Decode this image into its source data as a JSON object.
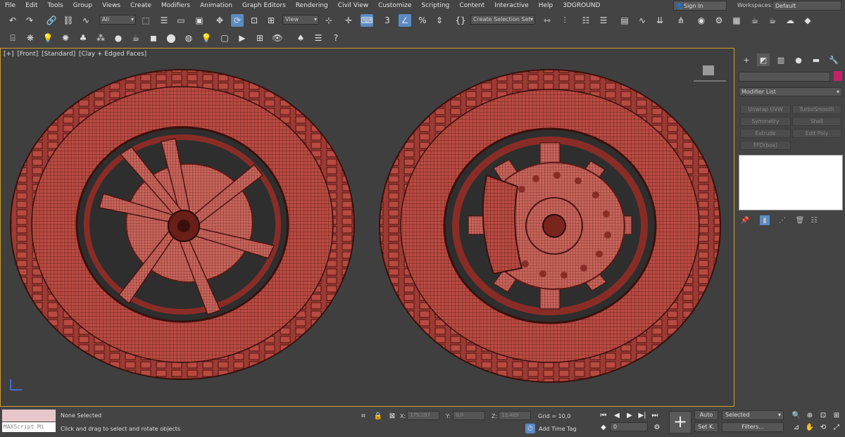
{
  "menu": [
    "File",
    "Edit",
    "Tools",
    "Group",
    "Views",
    "Create",
    "Modifiers",
    "Animation",
    "Graph Editors",
    "Rendering",
    "Civil View",
    "Customize",
    "Scripting",
    "Content",
    "Interactive",
    "Help",
    "3DGROUND"
  ],
  "signin": {
    "label": "Sign In"
  },
  "workspace": {
    "label": "Workspaces:",
    "value": "Default"
  },
  "toolbar": {
    "selection_filter": "All",
    "ref_coord": "View",
    "selection_set": "Create Selection Set"
  },
  "viewport": {
    "label_plus": "[+]",
    "label_view": "[Front]",
    "label_shading": "[Standard]",
    "label_mode": "[Clay + Edged Faces]"
  },
  "command_panel": {
    "modifier_list": "Modifier List",
    "modifier_buttons": [
      "Unwrap UVW",
      "TurboSmooth",
      "Symmetry",
      "Shell",
      "Extrude",
      "Edit Poly",
      "FFD(box)"
    ],
    "color_swatch": "#c4206a"
  },
  "status": {
    "maxscript": "MAXScript Mi",
    "selected": "None Selected",
    "prompt": "Click and drag to select and rotate objects",
    "x_label": "X:",
    "x_value": "175,197",
    "y_label": "Y:",
    "y_value": "0,0",
    "z_label": "Z:",
    "z_value": "13,489",
    "grid": "Grid = 10,0",
    "add_time_tag": "Add Time Tag",
    "frame": "0",
    "auto": "Auto",
    "setk": "Set K.",
    "selected_dd": "Selected",
    "filters": "Filters..."
  },
  "colors": {
    "accent": "#5b8bc4",
    "mesh": "#b84a42",
    "wire": "#4a1410",
    "viewport_border": "#c8a030"
  }
}
